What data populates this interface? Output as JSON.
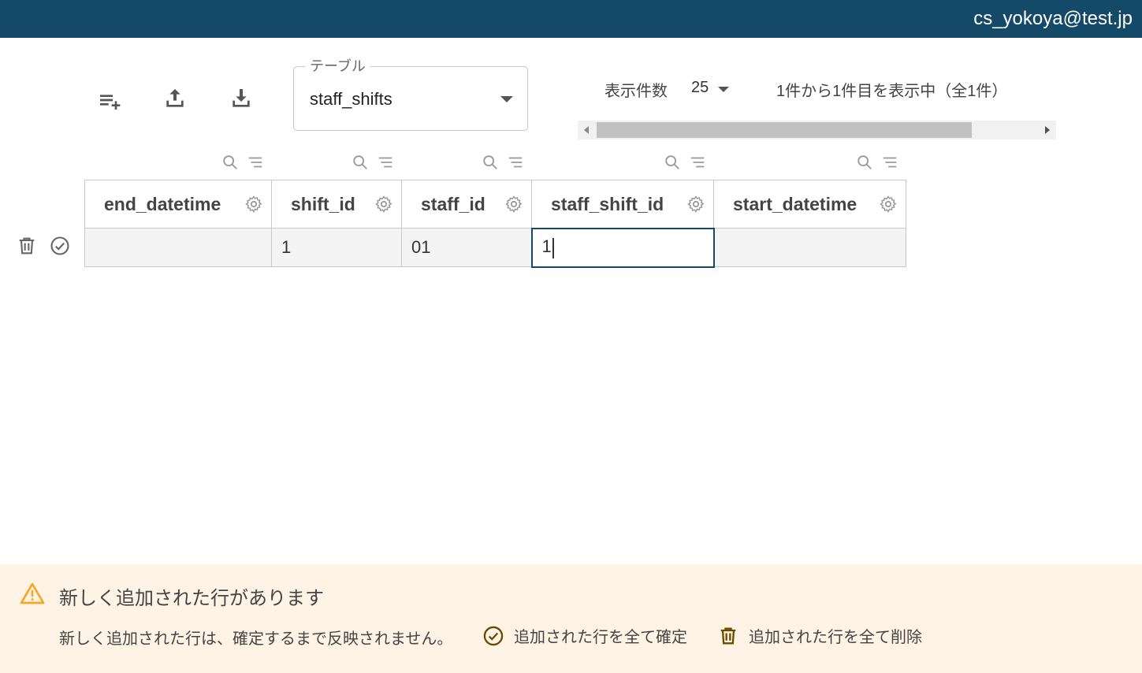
{
  "header": {
    "user_email": "cs_yokoya@test.jp",
    "background_color": "#144a68"
  },
  "toolbar": {
    "add_row_icon": "playlist-add-icon",
    "upload_icon": "upload-icon",
    "download_icon": "download-icon"
  },
  "table_select": {
    "label": "テーブル",
    "value": "staff_shifts"
  },
  "pagination": {
    "per_page_label": "表示件数",
    "per_page_value": "25",
    "range_text": "1件から1件目を表示中（全1件）"
  },
  "grid": {
    "columns": [
      {
        "name": "end_datetime"
      },
      {
        "name": "shift_id"
      },
      {
        "name": "staff_id"
      },
      {
        "name": "staff_shift_id"
      },
      {
        "name": "start_datetime"
      }
    ],
    "rows": [
      {
        "cells": [
          "",
          "1",
          "01",
          "1",
          ""
        ]
      }
    ]
  },
  "notice": {
    "title": "新しく追加された行があります",
    "text": "新しく追加された行は、確定するまで反映されません。",
    "confirm_all_label": "追加された行を全て確定",
    "delete_all_label": "追加された行を全て削除",
    "accent_color": "#f5a623",
    "action_color": "#6b4a00",
    "background_color": "#fef3e4"
  }
}
